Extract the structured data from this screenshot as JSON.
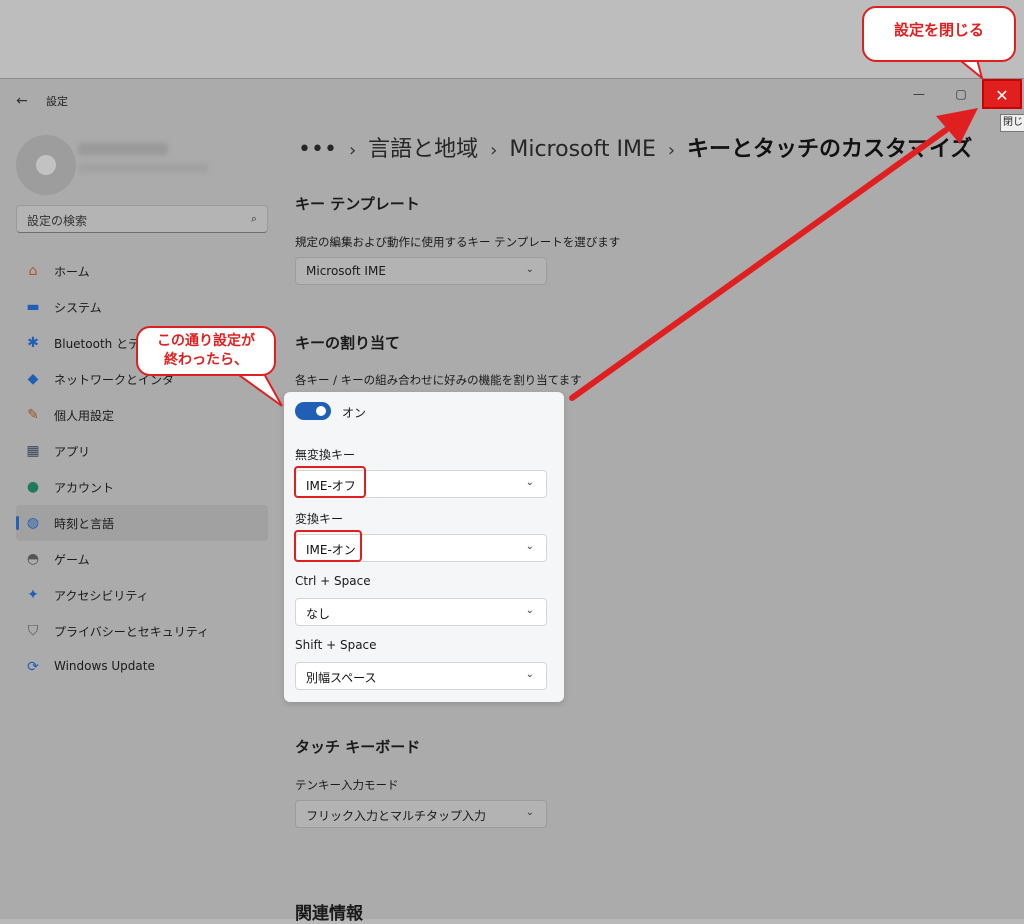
{
  "window": {
    "title": "設定",
    "back_glyph": "←",
    "minimize_glyph": "—",
    "maximize_glyph": "▢",
    "close_glyph": "✕",
    "close_tooltip": "閉じる"
  },
  "profile": {
    "avatar_icon": "user-avatar-icon"
  },
  "search": {
    "placeholder": "設定の検索",
    "icon": "search-icon"
  },
  "nav": {
    "items": [
      {
        "label": "ホーム",
        "icon": "home-icon",
        "glyph": "⌂",
        "color": "#b0562a"
      },
      {
        "label": "システム",
        "icon": "monitor-icon",
        "glyph": "▬",
        "color": "#1f5fb5"
      },
      {
        "label": "Bluetooth とデ",
        "icon": "bluetooth-icon",
        "glyph": "✱",
        "color": "#1f5fb5"
      },
      {
        "label": "ネットワークとインタ",
        "icon": "wifi-icon",
        "glyph": "◆",
        "color": "#1f5fb5"
      },
      {
        "label": "個人用設定",
        "icon": "brush-icon",
        "glyph": "✎",
        "color": "#a0521e"
      },
      {
        "label": "アプリ",
        "icon": "apps-icon",
        "glyph": "▦",
        "color": "#3a4a5a"
      },
      {
        "label": "アカウント",
        "icon": "account-icon",
        "glyph": "●",
        "color": "#1f7a5a"
      },
      {
        "label": "時刻と言語",
        "icon": "globe-clock-icon",
        "glyph": "◍",
        "color": "#1f5fb5"
      },
      {
        "label": "ゲーム",
        "icon": "gamepad-icon",
        "glyph": "◓",
        "color": "#555"
      },
      {
        "label": "アクセシビリティ",
        "icon": "accessibility-icon",
        "glyph": "✦",
        "color": "#1f5fb5"
      },
      {
        "label": "プライバシーとセキュリティ",
        "icon": "shield-icon",
        "glyph": "⛉",
        "color": "#555"
      },
      {
        "label": "Windows Update",
        "icon": "update-icon",
        "glyph": "⟳",
        "color": "#1f5fb5"
      }
    ],
    "selected_index": 7
  },
  "breadcrumb": {
    "more": "•••",
    "sep": "›",
    "items": [
      "言語と地域",
      "Microsoft IME"
    ],
    "current": "キーとタッチのカスタマイズ"
  },
  "key_template": {
    "title": "キー テンプレート",
    "desc": "規定の編集および動作に使用するキー テンプレートを選びます",
    "value": "Microsoft IME"
  },
  "key_assign": {
    "title": "キーの割り当て",
    "desc": "各キー / キーの組み合わせに好みの機能を割り当てます",
    "toggle_label": "オン",
    "toggle_on": true,
    "rows": [
      {
        "label": "無変換キー",
        "value": "IME-オフ"
      },
      {
        "label": "変換キー",
        "value": "IME-オン"
      },
      {
        "label": "Ctrl + Space",
        "value": "なし"
      },
      {
        "label": "Shift + Space",
        "value": "別幅スペース"
      }
    ]
  },
  "touch_keyboard": {
    "title": "タッチ キーボード",
    "desc": "テンキー入力モード",
    "value": "フリック入力とマルチタップ入力"
  },
  "related": {
    "title": "関連情報"
  },
  "annotations": {
    "callout1_line1": "この通り設定が",
    "callout1_line2": "終わったら、",
    "callout2": "設定を閉じる",
    "color": "#e02020"
  },
  "chevron": "⌄"
}
